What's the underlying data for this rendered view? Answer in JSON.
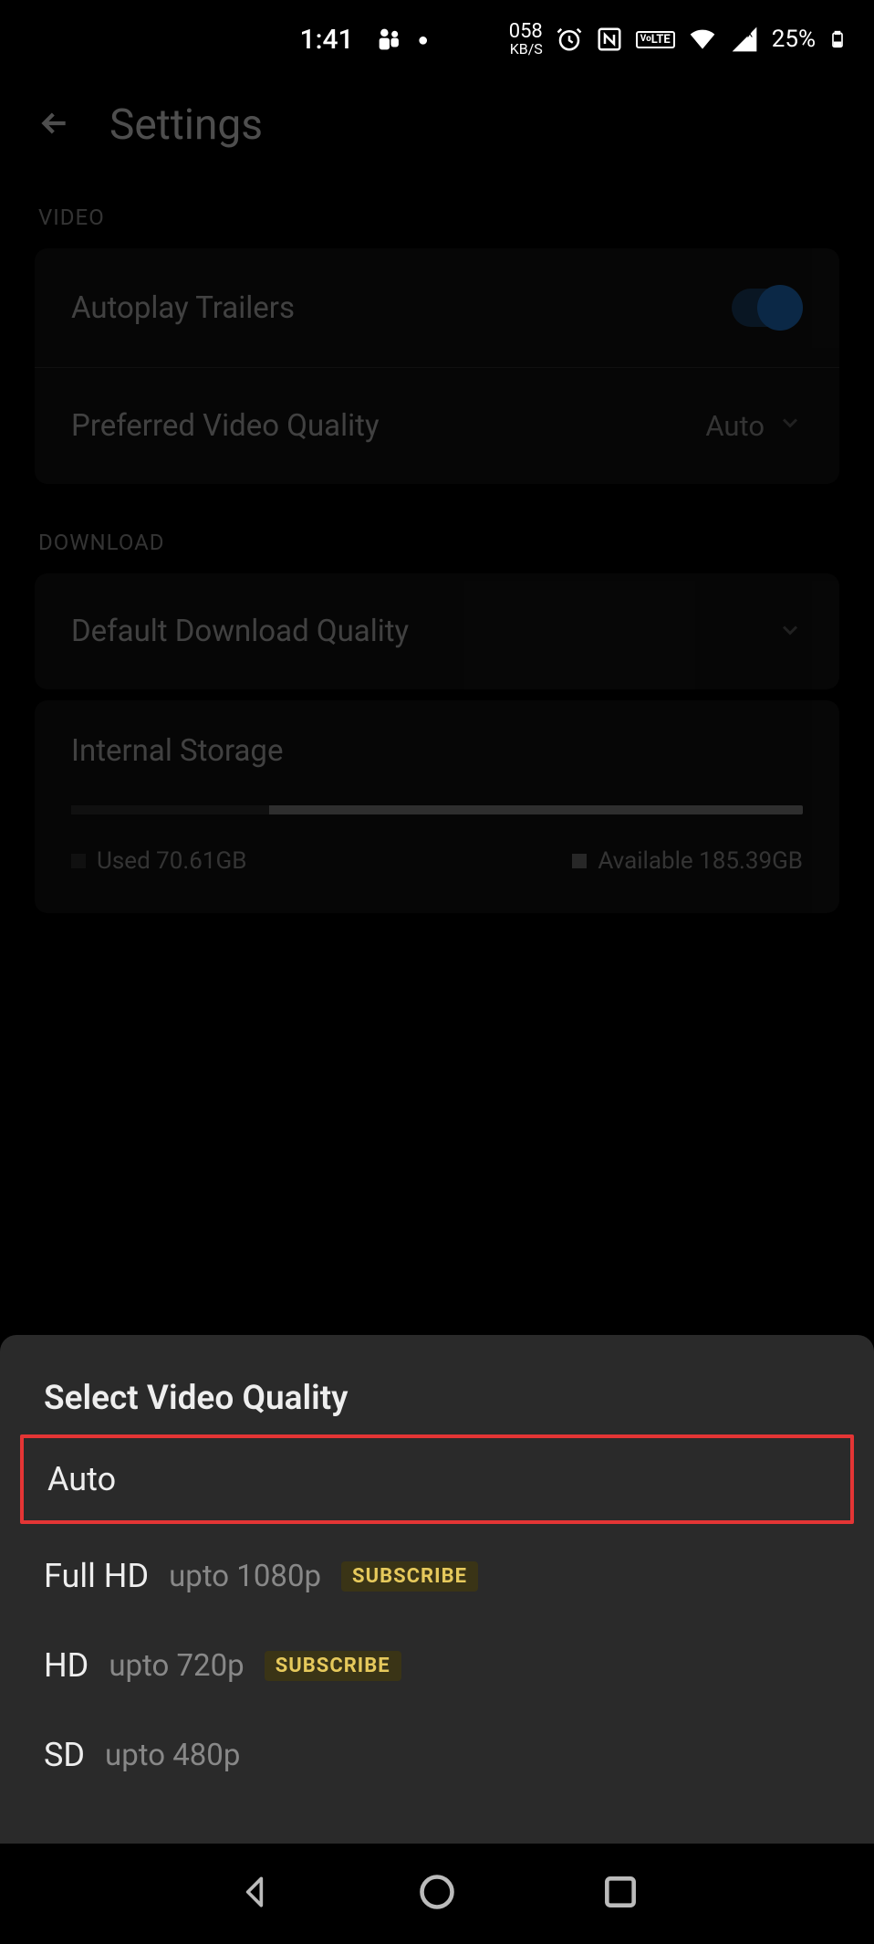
{
  "status_bar": {
    "time": "1:41",
    "kbs_num": "058",
    "kbs_label": "KB/S",
    "battery_pct": "25%",
    "volte": "VoLTE"
  },
  "header": {
    "title": "Settings"
  },
  "sections": {
    "video": {
      "label": "VIDEO",
      "autoplay_label": "Autoplay Trailers",
      "quality_label": "Preferred Video Quality",
      "quality_value": "Auto"
    },
    "download": {
      "label": "DOWNLOAD",
      "default_label": "Default Download Quality",
      "storage_label": "Internal Storage",
      "used": "Used 70.61GB",
      "available": "Available 185.39GB"
    }
  },
  "sheet": {
    "title": "Select Video Quality",
    "options": [
      {
        "label": "Auto",
        "sub": "",
        "badge": ""
      },
      {
        "label": "Full HD",
        "sub": "upto 1080p",
        "badge": "SUBSCRIBE"
      },
      {
        "label": "HD",
        "sub": "upto 720p",
        "badge": "SUBSCRIBE"
      },
      {
        "label": "SD",
        "sub": "upto 480p",
        "badge": ""
      }
    ]
  }
}
